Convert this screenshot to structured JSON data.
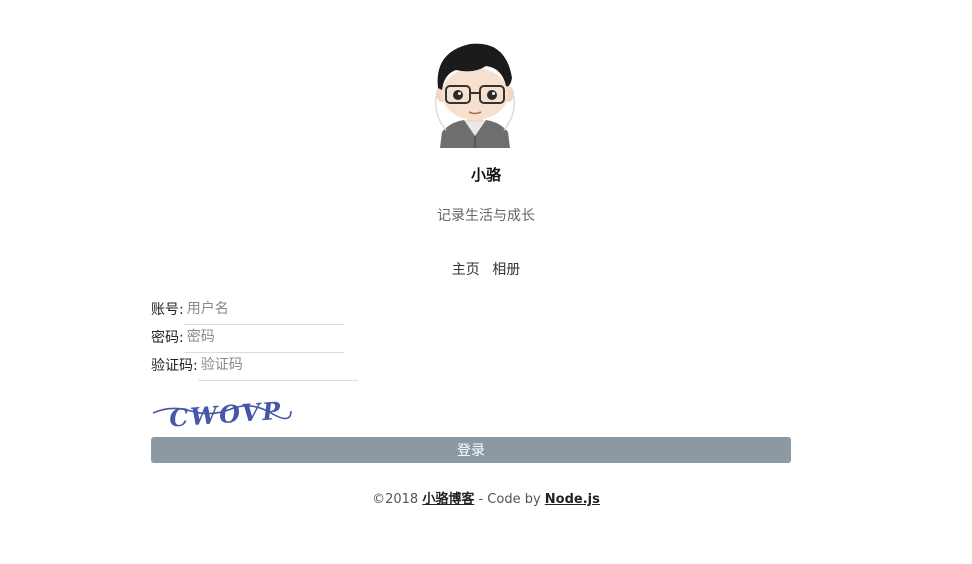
{
  "profile": {
    "avatar_icon": "avatar-cartoon-boy-glasses",
    "name": "小骆",
    "motto": "记录生活与成长"
  },
  "nav": {
    "items": [
      "主页",
      "相册"
    ]
  },
  "form": {
    "account_label": "账号:",
    "account_placeholder": "用户名",
    "password_label": "密码:",
    "password_placeholder": "密码",
    "captcha_label": "验证码:",
    "captcha_placeholder": "验证码",
    "captcha_text": "CWOVP",
    "submit_label": "登录"
  },
  "footer": {
    "copyright": "©2018 ",
    "site_link": "小骆博客",
    "middle": " - Code by ",
    "tech_link": "Node.js"
  },
  "colors": {
    "button_bg": "#8a99a4",
    "captcha_ink": "#4656a8"
  }
}
